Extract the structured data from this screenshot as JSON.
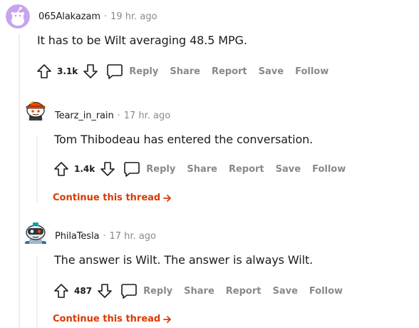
{
  "comments": [
    {
      "author": "065Alakazam",
      "time": "19 hr. ago",
      "text": "It has to be Wilt averaging 48.5 MPG.",
      "score": "3.1k",
      "actions": {
        "reply": "Reply",
        "share": "Share",
        "report": "Report",
        "save": "Save",
        "follow": "Follow"
      },
      "avatar": "default-snoo-avatar"
    },
    {
      "author": "Tearz_in_rain",
      "time": "17 hr. ago",
      "text": "Tom Thibodeau has entered the conversation.",
      "score": "1.4k",
      "actions": {
        "reply": "Reply",
        "share": "Share",
        "report": "Report",
        "save": "Save",
        "follow": "Follow"
      },
      "continue": "Continue this thread",
      "avatar": "snoo-with-orange-hat-avatar"
    },
    {
      "author": "PhilaTesla",
      "time": "17 hr. ago",
      "text": "The answer is Wilt. The answer is always Wilt.",
      "score": "487",
      "actions": {
        "reply": "Reply",
        "share": "Share",
        "report": "Report",
        "save": "Save",
        "follow": "Follow"
      },
      "continue": "Continue this thread",
      "avatar": "snoo-robot-avatar"
    }
  ],
  "colors": {
    "meta": "#878a8c",
    "action": "#878a8c",
    "continue": "#d93a00",
    "thread_line": "#edeff1",
    "avatar_default_bg": "#c8a4ec"
  }
}
